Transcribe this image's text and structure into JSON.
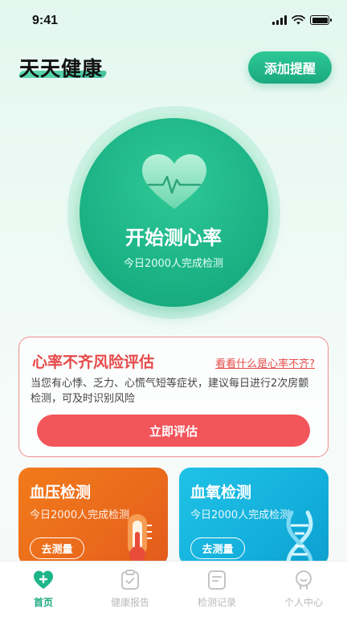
{
  "status_bar": {
    "time": "9:41"
  },
  "header": {
    "title": "天天健康",
    "add_reminder_label": "添加提醒"
  },
  "heart_rate": {
    "start_label": "开始测心率",
    "subtitle": "今日2000人完成检测"
  },
  "risk_card": {
    "title": "心率不齐风险评估",
    "link": "看看什么是心率不齐?",
    "description": "当您有心悸、乏力、心慌气短等症状，建议每日进行2次房颤检测，可及时识别风险",
    "button": "立即评估"
  },
  "cards": [
    {
      "title": "血压检测",
      "subtitle": "今日2000人完成检测",
      "button": "去测量",
      "color": "#f27a1a",
      "icon": "thermometer-icon"
    },
    {
      "title": "血氧检测",
      "subtitle": "今日2000人完成检测",
      "button": "去测量",
      "color": "#1fc2e6",
      "icon": "dna-icon"
    }
  ],
  "tabs": [
    {
      "label": "首页",
      "icon": "heart-plus-icon",
      "active": true
    },
    {
      "label": "健康报告",
      "icon": "clipboard-check-icon",
      "active": false
    },
    {
      "label": "检测记录",
      "icon": "document-icon",
      "active": false
    },
    {
      "label": "个人中心",
      "icon": "user-icon",
      "active": false
    }
  ],
  "colors": {
    "brand": "#1db587",
    "danger": "#f2555a"
  }
}
